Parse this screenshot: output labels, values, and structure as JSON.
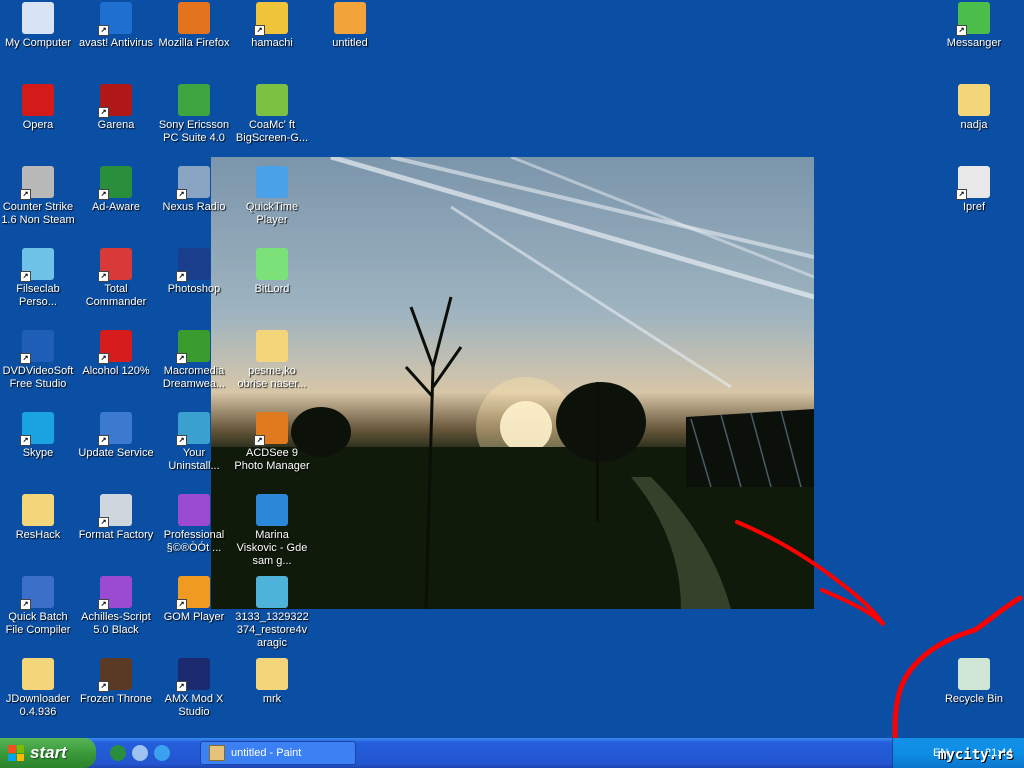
{
  "desktop": {
    "icons": [
      {
        "label": "My Computer",
        "icon": "my-computer-icon",
        "color": "#d8e4f4",
        "shortcut": false
      },
      {
        "label": "avast! Antivirus",
        "icon": "avast-icon",
        "color": "#1f6fd1",
        "shortcut": true
      },
      {
        "label": "Mozilla Firefox",
        "icon": "firefox-icon",
        "color": "#e3741d",
        "shortcut": false
      },
      {
        "label": "hamachi",
        "icon": "hamachi-icon",
        "color": "#f0c43a",
        "shortcut": true
      },
      {
        "label": "untitled",
        "icon": "jpg-file-icon",
        "color": "#f2a33a",
        "shortcut": false
      },
      {
        "label": "Opera",
        "icon": "opera-icon",
        "color": "#d51a1a",
        "shortcut": false
      },
      {
        "label": "Garena",
        "icon": "garena-icon",
        "color": "#b01818",
        "shortcut": true
      },
      {
        "label": "Sony Ericsson PC Suite 4.0",
        "icon": "sony-ericsson-icon",
        "color": "#3da641",
        "shortcut": false
      },
      {
        "label": "CoaMc' ft BigScreen-G...",
        "icon": "mp4-file-icon",
        "color": "#7cc142",
        "shortcut": false
      },
      {
        "label": "Counter Strike 1.6 Non Steam",
        "icon": "counter-strike-icon",
        "color": "#b9b9b9",
        "shortcut": true
      },
      {
        "label": "Ad-Aware",
        "icon": "ad-aware-icon",
        "color": "#2a8f3d",
        "shortcut": true
      },
      {
        "label": "Nexus Radio",
        "icon": "nexus-radio-icon",
        "color": "#8aa4c4",
        "shortcut": true
      },
      {
        "label": "QuickTime Player",
        "icon": "quicktime-icon",
        "color": "#4aa1e8",
        "shortcut": false
      },
      {
        "label": "Filseclab Perso...",
        "icon": "filseclab-icon",
        "color": "#6fc2e8",
        "shortcut": true
      },
      {
        "label": "Total Commander",
        "icon": "total-commander-icon",
        "color": "#d83a3a",
        "shortcut": true
      },
      {
        "label": "Photoshop",
        "icon": "photoshop-icon",
        "color": "#1a3e8c",
        "shortcut": true
      },
      {
        "label": "BitLord",
        "icon": "bitlord-icon",
        "color": "#7be27a",
        "shortcut": false
      },
      {
        "label": "DVDVideoSoft Free Studio",
        "icon": "dvdvideosoft-icon",
        "color": "#1f5fb8",
        "shortcut": true
      },
      {
        "label": "Alcohol 120%",
        "icon": "alcohol-icon",
        "color": "#d61c1c",
        "shortcut": true
      },
      {
        "label": "Macromedia Dreamwea...",
        "icon": "dreamweaver-icon",
        "color": "#3a9c2f",
        "shortcut": true
      },
      {
        "label": "pesme,ko obrise naser...",
        "icon": "folder-icon",
        "color": "#f4d67a",
        "shortcut": false
      },
      {
        "label": "Skype",
        "icon": "skype-icon",
        "color": "#19a3e0",
        "shortcut": true
      },
      {
        "label": "Update Service",
        "icon": "update-service-icon",
        "color": "#3c7ad0",
        "shortcut": true
      },
      {
        "label": "Your Uninstall...",
        "icon": "your-uninstaller-icon",
        "color": "#3aa0d0",
        "shortcut": true
      },
      {
        "label": "ACDSee 9 Photo Manager",
        "icon": "acdsee-icon",
        "color": "#e07a1e",
        "shortcut": true
      },
      {
        "label": "ResHack",
        "icon": "folder-icon",
        "color": "#f4d67a",
        "shortcut": false
      },
      {
        "label": "Format Factory",
        "icon": "format-factory-icon",
        "color": "#cfd6de",
        "shortcut": true
      },
      {
        "label": "Professional §©®ÒÓt ...",
        "icon": "professional-icon",
        "color": "#9b4bd1",
        "shortcut": false
      },
      {
        "label": "Marina Viskovic - Gde sam g...",
        "icon": "media-player-icon",
        "color": "#2b88d8",
        "shortcut": false
      },
      {
        "label": "Quick Batch File Compiler",
        "icon": "batch-compiler-icon",
        "color": "#3b6fc8",
        "shortcut": true
      },
      {
        "label": "Achilles-Script 5.0 Black",
        "icon": "achilles-icon",
        "color": "#9b4bd1",
        "shortcut": true
      },
      {
        "label": "GOM Player",
        "icon": "gom-player-icon",
        "color": "#f19a22",
        "shortcut": true
      },
      {
        "label": "3133_1329322 374_restore4v aragic",
        "icon": "archive-icon",
        "color": "#4db3d8",
        "shortcut": false
      },
      {
        "label": "JDownloader 0.4.936",
        "icon": "folder-icon",
        "color": "#f4d67a",
        "shortcut": false
      },
      {
        "label": "Frozen Throne",
        "icon": "frozen-throne-icon",
        "color": "#5a3a24",
        "shortcut": true
      },
      {
        "label": "AMX Mod X Studio",
        "icon": "amx-mod-icon",
        "color": "#1c2a70",
        "shortcut": true
      },
      {
        "label": "mrk",
        "icon": "folder-icon",
        "color": "#f4d67a",
        "shortcut": false
      },
      {
        "label": "Messanger",
        "icon": "messenger-icon",
        "color": "#4bbd4b",
        "shortcut": true
      },
      {
        "label": "nadja",
        "icon": "folder-icon",
        "color": "#f4d67a",
        "shortcut": false
      },
      {
        "label": "Ipref",
        "icon": "ipref-icon",
        "color": "#e8e8e8",
        "shortcut": true
      },
      {
        "label": "Recycle Bin",
        "icon": "recycle-bin-icon",
        "color": "#cfe6d4",
        "shortcut": false
      }
    ]
  },
  "taskbar": {
    "start_label": "start",
    "quick_launch": [
      {
        "name": "ad-aware-quicklaunch-icon",
        "color": "#2a8f3d"
      },
      {
        "name": "show-desktop-icon",
        "color": "#9ec3f0"
      },
      {
        "name": "internet-explorer-icon",
        "color": "#3ba0f0"
      }
    ],
    "task_button_label": "untitled - Paint",
    "tray_language": "EN",
    "clock": "21:44"
  },
  "watermark": "mycity.rs",
  "colors": {
    "desktop": "#0a4fa3",
    "annotation": "#ff0000"
  }
}
